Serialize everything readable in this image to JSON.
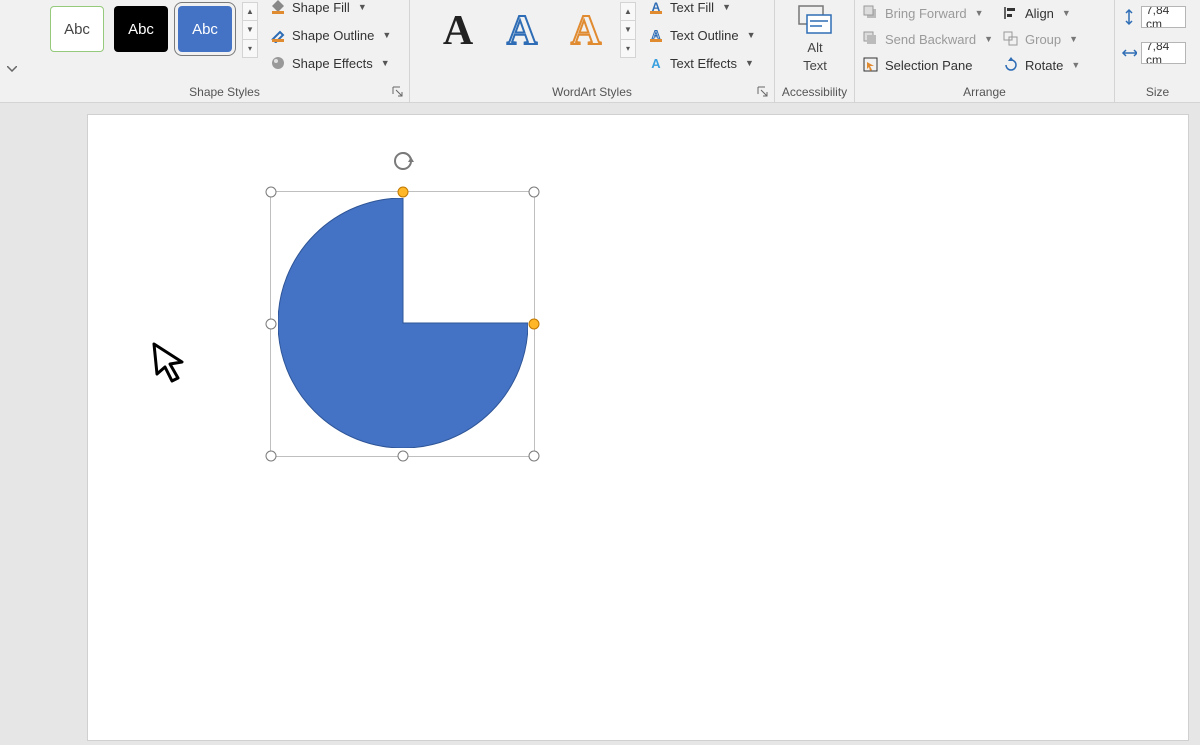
{
  "ribbon": {
    "shape_styles": {
      "thumbs": [
        "Abc",
        "Abc",
        "Abc"
      ],
      "cmds": {
        "fill": "Shape Fill",
        "outline": "Shape Outline",
        "effects": "Shape Effects"
      },
      "label": "Shape Styles"
    },
    "wordart_styles": {
      "letter": "A",
      "cmds": {
        "fill": "Text Fill",
        "outline": "Text Outline",
        "effects": "Text Effects"
      },
      "label": "WordArt Styles"
    },
    "accessibility": {
      "alt_line1": "Alt",
      "alt_line2": "Text",
      "label": "Accessibility"
    },
    "arrange": {
      "bring_forward": "Bring Forward",
      "send_backward": "Send Backward",
      "selection_pane": "Selection Pane",
      "align": "Align",
      "group": "Group",
      "rotate": "Rotate",
      "label": "Arrange"
    },
    "size": {
      "height": "7,84 cm",
      "width": "7,84 cm",
      "label": "Size"
    }
  }
}
